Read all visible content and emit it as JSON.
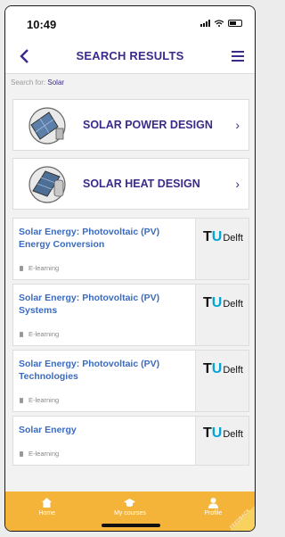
{
  "status_bar": {
    "time": "10:49"
  },
  "nav": {
    "title": "SEARCH RESULTS"
  },
  "search": {
    "prefix": "Search for:",
    "query": "Solar"
  },
  "topics": [
    {
      "label": "SOLAR POWER DESIGN"
    },
    {
      "label": "SOLAR HEAT DESIGN"
    }
  ],
  "courses": [
    {
      "title": "Solar Energy: Photovoltaic (PV) Energy Conversion",
      "type": "E-learning",
      "provider_tu": "T",
      "provider_u": "U",
      "provider_rest": "Delft"
    },
    {
      "title": "Solar Energy: Photovoltaic (PV) Systems",
      "type": "E-learning",
      "provider_tu": "T",
      "provider_u": "U",
      "provider_rest": "Delft"
    },
    {
      "title": "Solar Energy: Photovoltaic (PV) Technologies",
      "type": "E-learning",
      "provider_tu": "T",
      "provider_u": "U",
      "provider_rest": "Delft"
    },
    {
      "title": "Solar Energy",
      "type": "E-learning",
      "provider_tu": "T",
      "provider_u": "U",
      "provider_rest": "Delft"
    }
  ],
  "tabbar": {
    "home": "Home",
    "courses": "My courses",
    "profile": "Profile"
  },
  "feedback": "FEEDBACK",
  "colors": {
    "accent": "#3b2a8a",
    "link": "#3b6bbf",
    "tabbar": "#f4b43a",
    "tu_blue": "#00a6d6"
  }
}
